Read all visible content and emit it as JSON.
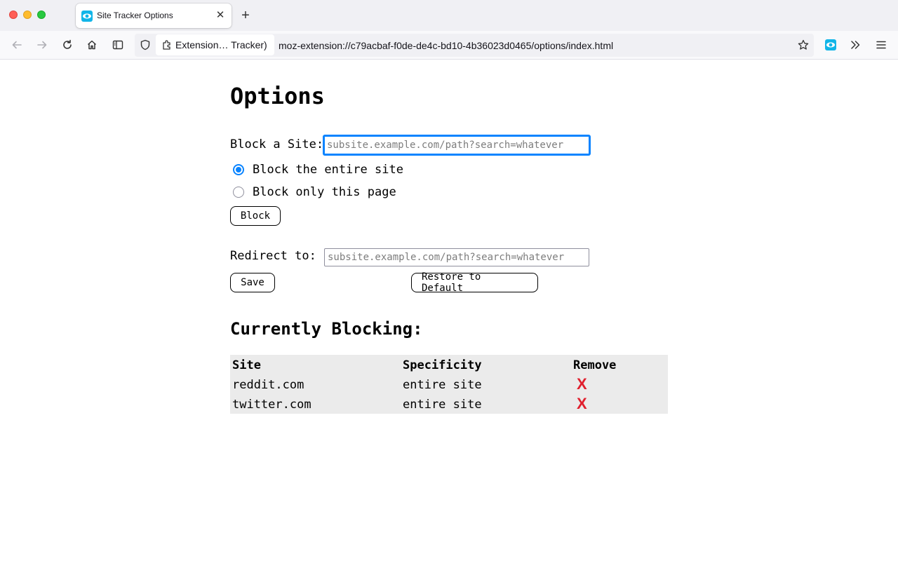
{
  "browser": {
    "tab_title": "Site Tracker Options",
    "tab_favicon": "eye-icon",
    "identity_label": "Extension… Tracker)",
    "url": "moz-extension://c79acbaf-f0de-de4c-bd10-4b36023d0465/options/index.html",
    "accent_color": "#0a84ff"
  },
  "page": {
    "title": "Options",
    "block_label": "Block a Site:",
    "block_placeholder": "subsite.example.com/path?search=whatever",
    "radio_entire": "Block the entire site",
    "radio_page": "Block only this page",
    "selected_radio": "entire",
    "block_button": "Block",
    "redirect_label": "Redirect to:",
    "redirect_placeholder": "subsite.example.com/path?search=whatever",
    "save_button": "Save",
    "restore_button": "Restore to Default",
    "blocking_heading": "Currently Blocking:"
  },
  "table": {
    "headers": [
      "Site",
      "Specificity",
      "Remove"
    ],
    "rows": [
      {
        "site": "reddit.com",
        "specificity": "entire site",
        "remove": "X"
      },
      {
        "site": "twitter.com",
        "specificity": "entire site",
        "remove": "X"
      }
    ],
    "remove_color": "#e0202e"
  }
}
